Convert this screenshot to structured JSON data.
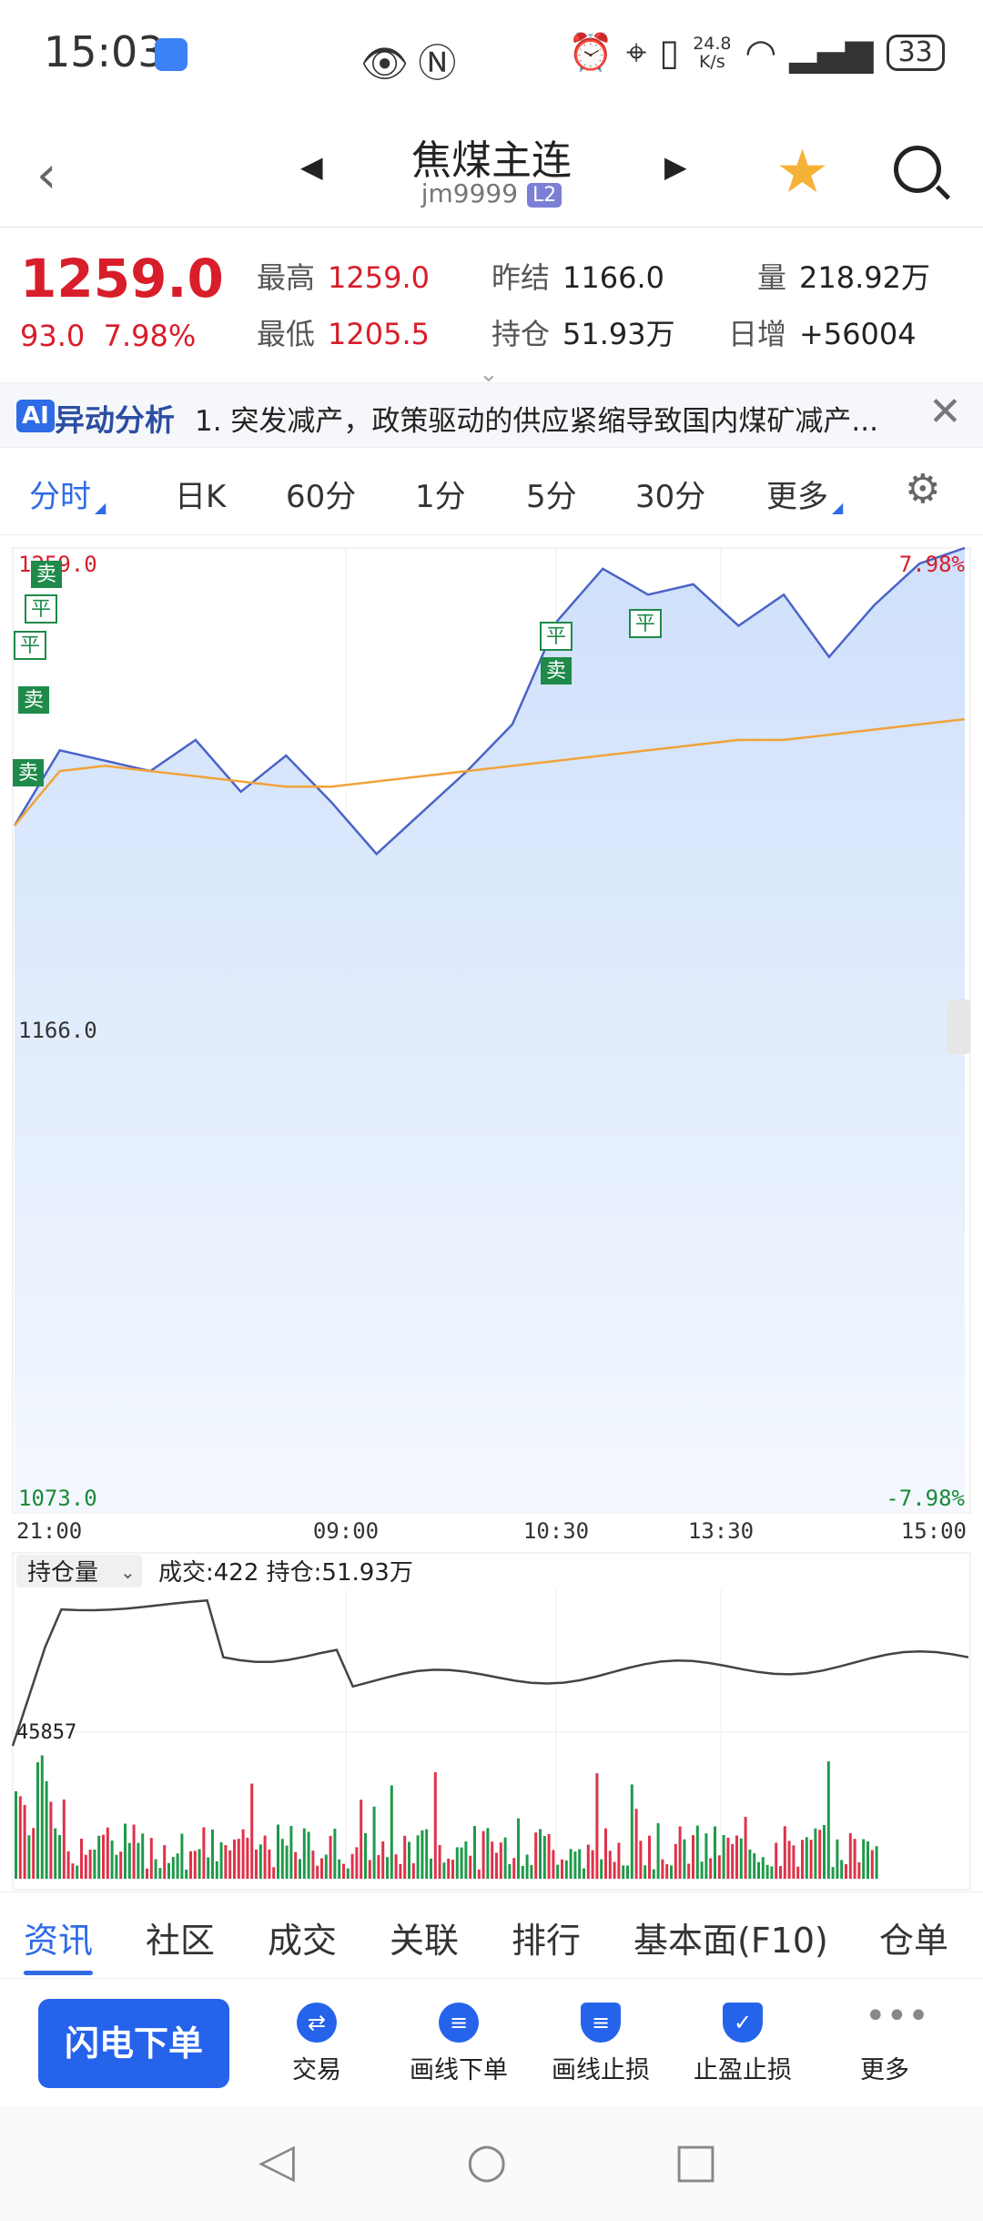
{
  "status_bar": {
    "time": "15:03",
    "net_speed": "24.8 K/s",
    "battery": "33",
    "icons": [
      "app-icon",
      "eye-icon",
      "nfc-icon",
      "alarm-icon",
      "location-icon",
      "vibrate-icon",
      "wifi-icon",
      "signal-icon",
      "battery-icon"
    ]
  },
  "header": {
    "title": "焦煤主连",
    "code": "jm9999",
    "badge": "L2"
  },
  "quote": {
    "price": "1259.0",
    "change": "93.0",
    "change_pct": "7.98%",
    "high_label": "最高",
    "high": "1259.0",
    "low_label": "最低",
    "low": "1205.5",
    "prev_settle_label": "昨结",
    "prev_settle": "1166.0",
    "open_interest_label": "持仓",
    "open_interest": "51.93万",
    "volume_label": "量",
    "volume": "218.92万",
    "daily_inc_label": "日增",
    "daily_inc": "+56004"
  },
  "ai_bar": {
    "badge": "AI",
    "title": "异动分析",
    "text": "1. 突发减产，政策驱动的供应紧缩导致国内煤矿减产..."
  },
  "period_tabs": [
    "分时",
    "日K",
    "60分",
    "1分",
    "5分",
    "30分",
    "更多"
  ],
  "chart": {
    "upper_price": "1259.0",
    "upper_pct": "7.98%",
    "mid_price": "1166.0",
    "lower_price": "1073.0",
    "lower_pct": "-7.98%",
    "time_labels": [
      "21:00",
      "09:00",
      "10:30",
      "13:30",
      "15:00"
    ],
    "markers": [
      "卖",
      "平",
      "平",
      "卖",
      "卖",
      "平",
      "卖",
      "平"
    ],
    "sub_selector": "持仓量",
    "sub_info": "成交:422  持仓:51.93万",
    "sub_value": "45857"
  },
  "chart_data": {
    "type": "line",
    "title": "",
    "ylim": [
      1073.0,
      1259.0
    ],
    "reference": 1166.0,
    "x": [
      "21:00",
      "09:00",
      "10:30",
      "13:30",
      "15:00"
    ],
    "series": [
      {
        "values": [
          1205.5,
          1220,
          1218,
          1216,
          1222,
          1212,
          1219,
          1210,
          1200,
          1208,
          1216,
          1225,
          1245,
          1255,
          1250,
          1252,
          1244,
          1250,
          1238,
          1248,
          1256,
          1259
        ]
      },
      {
        "values": [
          1205.5,
          1216,
          1217,
          1216,
          1215,
          1214,
          1213,
          1213,
          1214,
          1215,
          1216,
          1217,
          1218,
          1219,
          1220,
          1221,
          1222,
          1222,
          1223,
          1224,
          1225,
          1226
        ]
      }
    ]
  },
  "bottom_tabs": [
    "资讯",
    "社区",
    "成交",
    "关联",
    "排行",
    "基本面(F10)",
    "仓单"
  ],
  "actions": {
    "flash_order": "闪电下单",
    "items": [
      "交易",
      "画线下单",
      "画线止损",
      "止盈止损",
      "更多"
    ]
  }
}
